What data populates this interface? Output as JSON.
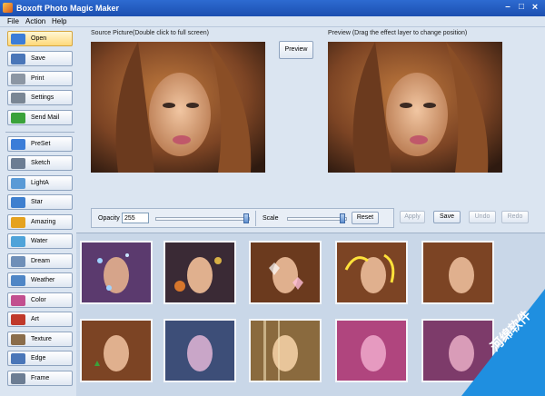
{
  "window": {
    "title": "Boxoft Photo Magic Maker"
  },
  "menu": [
    "File",
    "Action",
    "Help"
  ],
  "sidebar": {
    "file_buttons": [
      {
        "label": "Open",
        "icon": "folder-icon",
        "color": "#3b7dd8"
      },
      {
        "label": "Save",
        "icon": "save-icon",
        "color": "#4a76b8"
      },
      {
        "label": "Print",
        "icon": "print-icon",
        "color": "#8c96a3"
      },
      {
        "label": "Settings",
        "icon": "gear-icon",
        "color": "#7a8694"
      },
      {
        "label": "Send Mail",
        "icon": "mail-arrow-icon",
        "color": "#3aa23a"
      }
    ],
    "effect_buttons": [
      {
        "label": "PreSet",
        "icon": "preset-icon",
        "color": "#3b7dd8"
      },
      {
        "label": "Sketch",
        "icon": "sketch-icon",
        "color": "#6c7d93"
      },
      {
        "label": "LightA",
        "icon": "light-icon",
        "color": "#5a9ad6"
      },
      {
        "label": "Star",
        "icon": "star-icon",
        "color": "#3e7fcf"
      },
      {
        "label": "Amazing",
        "icon": "amazing-icon",
        "color": "#e5a21f"
      },
      {
        "label": "Water",
        "icon": "water-icon",
        "color": "#4fa3d9"
      },
      {
        "label": "Dream",
        "icon": "dream-icon",
        "color": "#6f8fb8"
      },
      {
        "label": "Weather",
        "icon": "weather-icon",
        "color": "#4f86c6"
      },
      {
        "label": "Color",
        "icon": "color-icon",
        "color": "#c24f8f"
      },
      {
        "label": "Art",
        "icon": "art-icon",
        "color": "#c0392b"
      },
      {
        "label": "Texture",
        "icon": "texture-icon",
        "color": "#8a6d4b"
      },
      {
        "label": "Edge",
        "icon": "edge-icon",
        "color": "#4a76b8"
      },
      {
        "label": "Frame",
        "icon": "frame-icon",
        "color": "#6c7d93"
      }
    ]
  },
  "source": {
    "caption": "Source Picture(Double click to full screen)"
  },
  "preview": {
    "button": "Preview",
    "caption": "Preview (Drag the effect layer to change position)"
  },
  "controls": {
    "opacity_label": "Opacity",
    "opacity_value": "255",
    "opacity_level": 1.0,
    "scale_label": "Scale",
    "scale_level": 1.0,
    "reset": "Reset",
    "apply": "Apply",
    "save": "Save",
    "undo": "Undo",
    "redo": "Redo"
  },
  "watermark": {
    "text": "河绵软件"
  },
  "colors": {
    "title_bar": "#1c4fb0",
    "active_button": "#ffd979",
    "panel_bg": "#dbe5f1",
    "effects_bg": "#c9d7e8",
    "watermark": "#1f8fe0"
  }
}
